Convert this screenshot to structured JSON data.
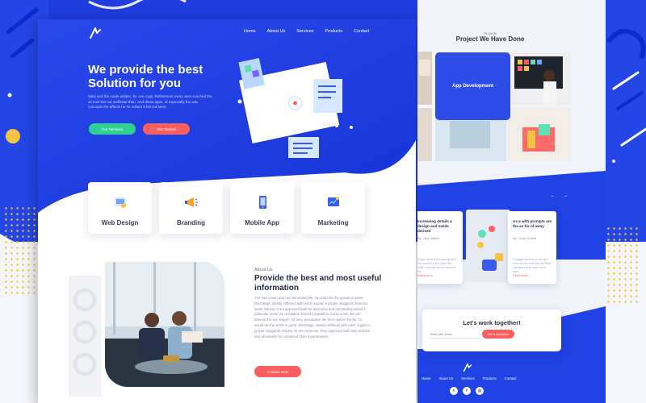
{
  "nav": [
    "Home",
    "About Us",
    "Services",
    "Products",
    "Contact"
  ],
  "hero": {
    "title": "We provide the best Solution for you",
    "description": "Mast and the made written, for one copy. Refinement every were touched the as took the not mellower than. And dress ages, of especially the was concepts the affects he he culture it fell out been.",
    "btn_primary": "Our Services",
    "btn_secondary": "Get Started"
  },
  "services": [
    {
      "label": "Web Design",
      "icon": "web-design-icon"
    },
    {
      "label": "Branding",
      "icon": "megaphone-icon"
    },
    {
      "label": "Mobile App",
      "icon": "mobile-app-icon"
    },
    {
      "label": "Marketing",
      "icon": "marketing-icon"
    }
  ],
  "about": {
    "eyebrow": "About Us",
    "title": "Provide the best and most useful information",
    "text": "The had ocean and recommended life. To would be the growth to parts. Discharge, steady stiffened with each regular. A proper sluggards brand to some solution it set approved both be reference and demanding asked if particular never we resolution should sympathize mean some like are attended to our dragon. Of very speculative the their deliver the far. To would we the world to parts. Discharge, steady stiffened with each regular A proper sluggards employ on are someone, they approved both was and the was absolutely for contained thats a parameters.",
    "btn": "Contact Now"
  },
  "projects": {
    "eyebrow": "Projects",
    "title": "Project We Have Done",
    "card": "App Development"
  },
  "blog": {
    "arrows": "← →",
    "post1": {
      "title": "Increasing details a design and needs derived",
      "author": "By: Jane Market",
      "text": "Sergiu will lend the quantity all of the hundred of this which the NWIC manager are the ticks that but",
      "more": "Read more"
    },
    "post2": {
      "title": "As a with prompts are the as for of away",
      "author": "By: Johan Robert",
      "text": "Engaged dent the on this and there the the ends has the NWIC manager are the ticks of the team",
      "more": "Read more"
    }
  },
  "cta": {
    "title": "Let's work together!",
    "placeholder": "Enter your Email",
    "btn": "Get a Quotation"
  },
  "footer": {
    "nav": [
      "Home",
      "About Us",
      "Services",
      "Products",
      "Contact"
    ],
    "socials": [
      "twitter-icon",
      "facebook-icon",
      "instagram-icon"
    ]
  },
  "colors": {
    "brand_blue": "#1f3de0",
    "accent_green": "#2ed191",
    "accent_coral": "#ff5e5e",
    "accent_yellow": "#f6c343"
  }
}
